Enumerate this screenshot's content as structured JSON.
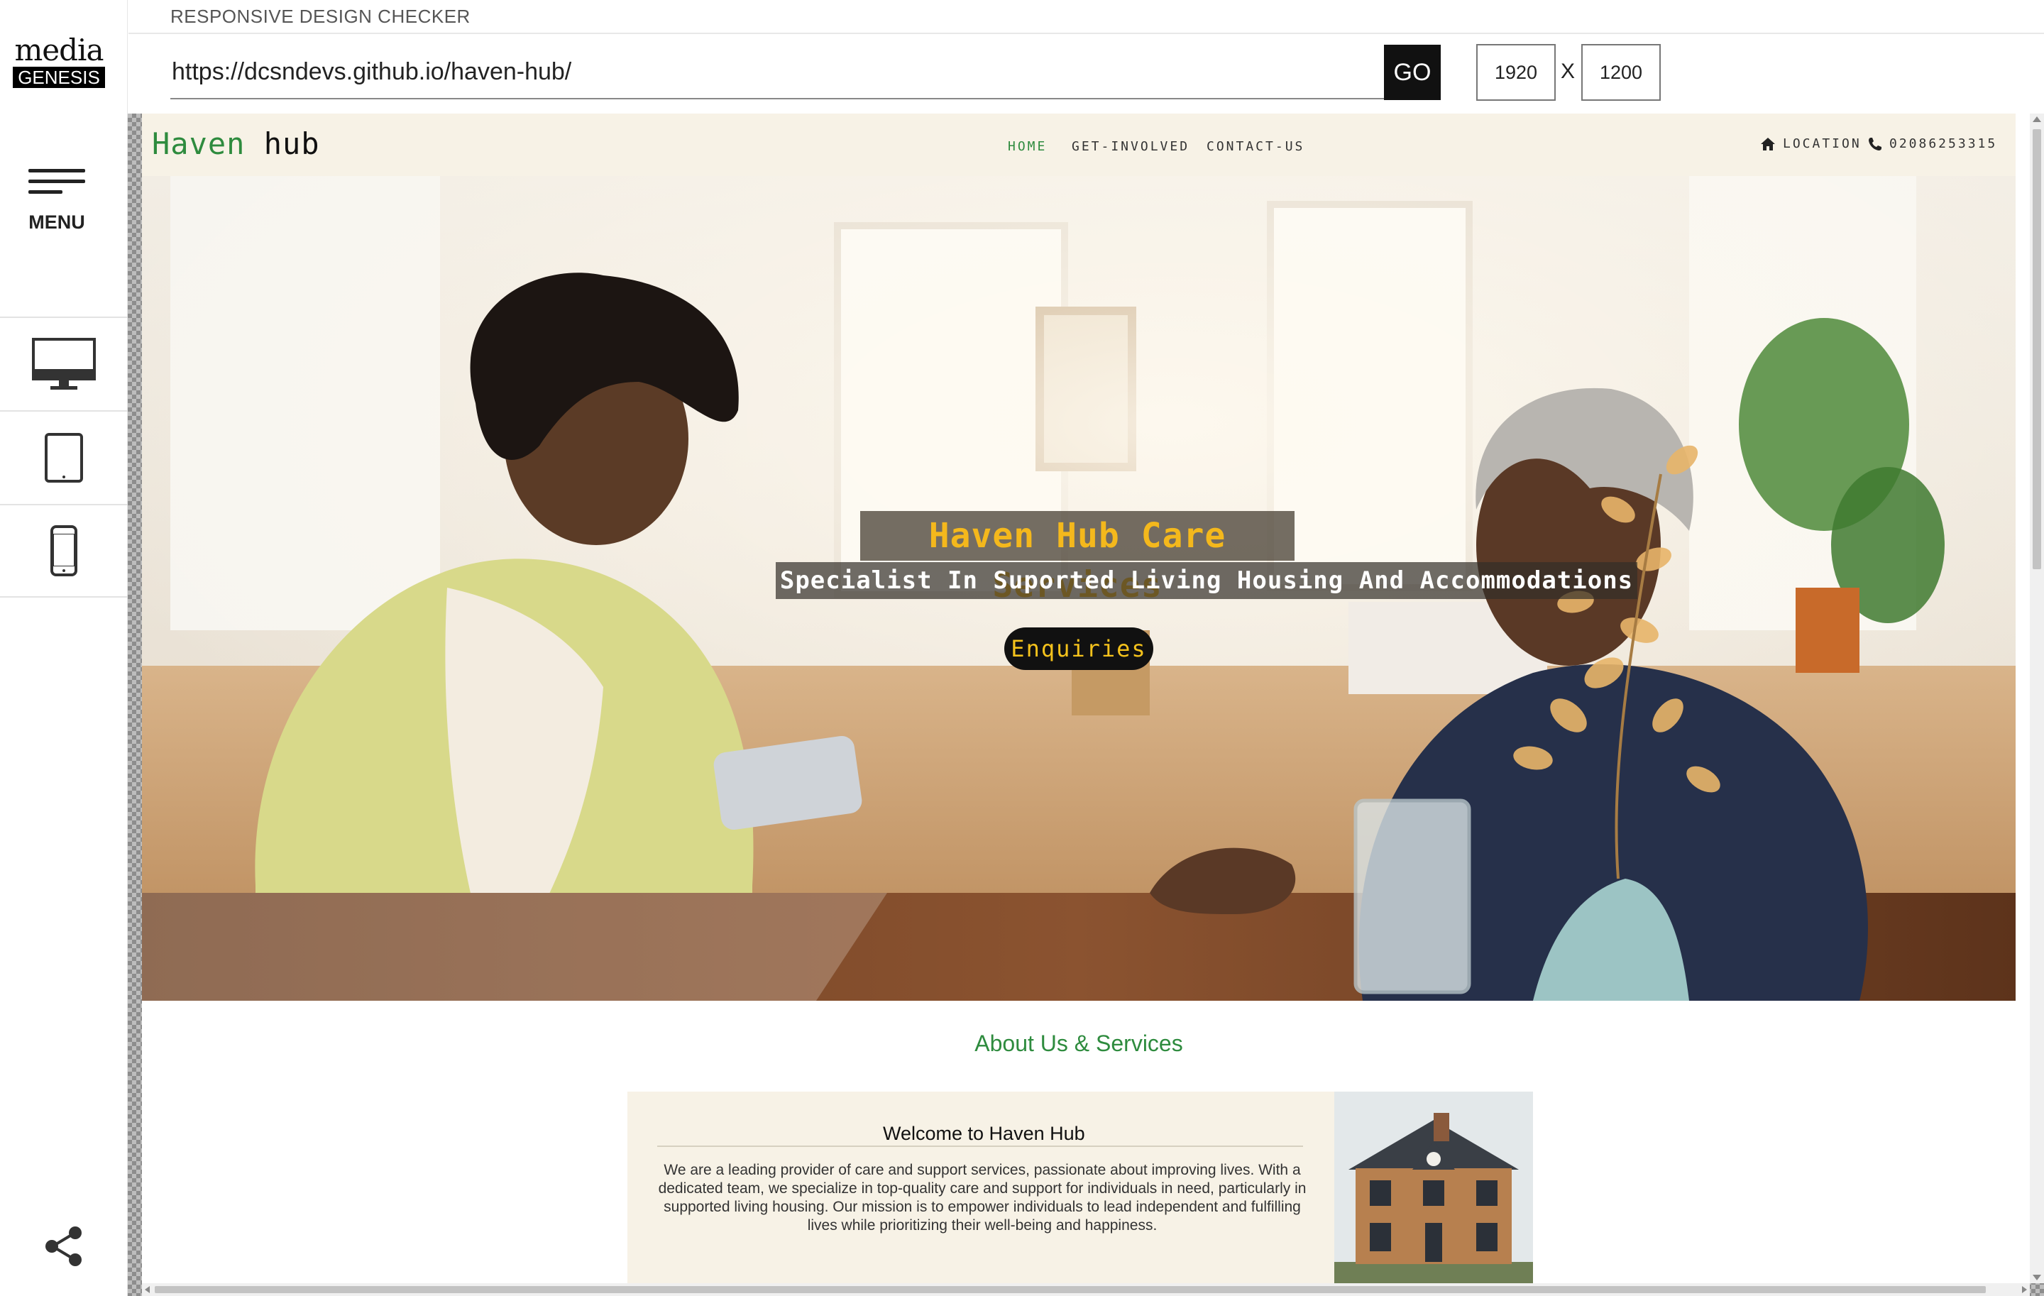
{
  "app": {
    "title": "RESPONSIVE DESIGN CHECKER",
    "logo_line1": "media",
    "logo_line2": "GENESIS",
    "menu_label": "MENU"
  },
  "toolbar": {
    "url": "https://dcsndevs.github.io/haven-hub/",
    "go_label": "GO",
    "width": "1920",
    "height": "1200",
    "x_label": "X"
  },
  "devices": [
    "desktop-icon",
    "tablet-icon",
    "phone-icon"
  ],
  "site": {
    "logo_green": "Haven",
    "logo_dark": "hub",
    "nav": {
      "home": "HOME",
      "get_involved": "GET-INVOLVED",
      "contact_us": "CONTACT-US",
      "location": "LOCATION",
      "phone": "02086253315"
    },
    "hero": {
      "title": "Haven Hub Care Services",
      "subtitle": "Specialist In Suported Living Housing And Accommodations",
      "button": "Enquiries"
    },
    "about": {
      "heading": "About Us & Services",
      "welcome_title": "Welcome to Haven Hub",
      "welcome_text": "We are a leading provider of care and support services, passionate about improving lives. With a dedicated team, we specialize in top-quality care and support for individuals in need, particularly in supported living housing. Our mission is to empower individuals to lead independent and fulfilling lives while prioritizing their well-being and happiness."
    }
  },
  "colors": {
    "brand_green": "#2e8b3e",
    "nav_bg": "#f7f2e6",
    "hero_title": "#f4b81c",
    "button_bg": "#111111"
  }
}
